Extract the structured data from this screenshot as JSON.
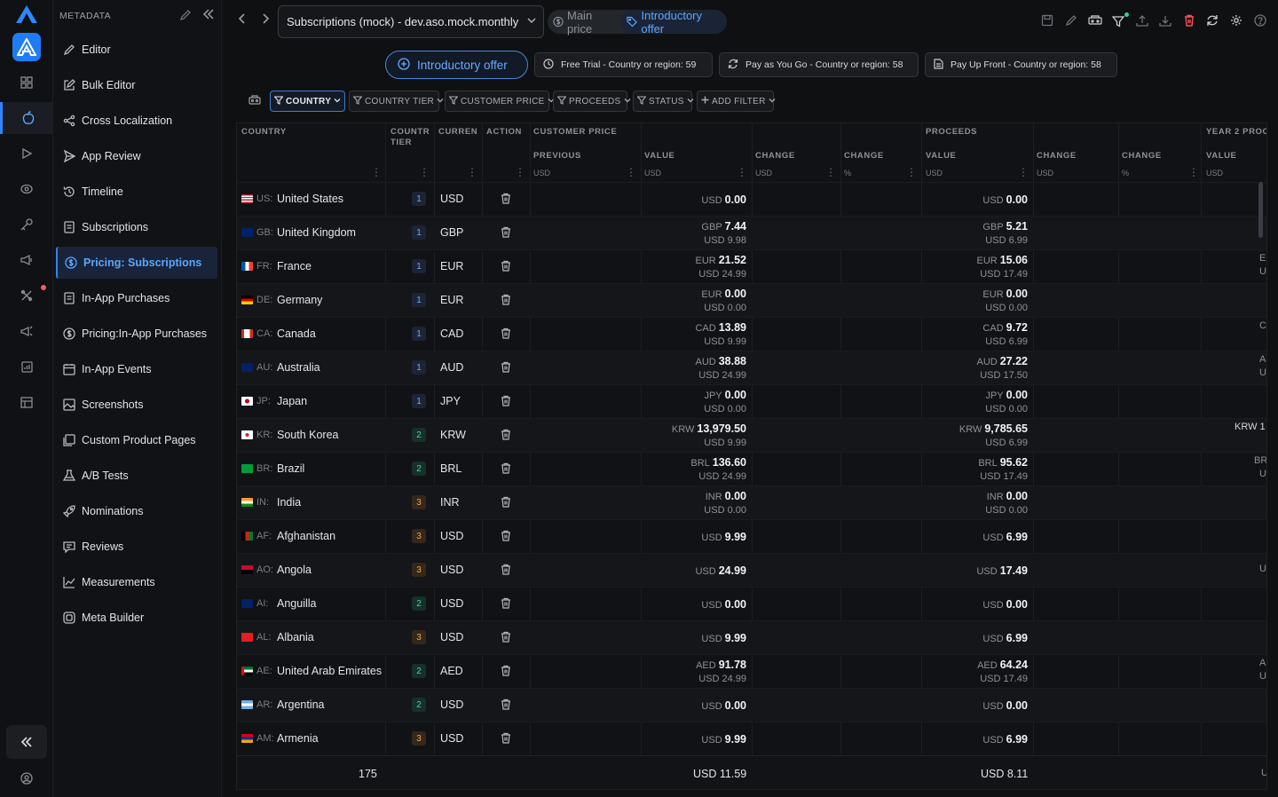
{
  "sidebar": {
    "title": "METADATA",
    "items": [
      {
        "label": "Editor",
        "icon": "pencil-icon"
      },
      {
        "label": "Bulk Editor",
        "icon": "edit-box-icon"
      },
      {
        "label": "Cross Localization",
        "icon": "share-icon"
      },
      {
        "label": "App Review",
        "icon": "send-icon"
      },
      {
        "label": "Timeline",
        "icon": "history-icon"
      },
      {
        "label": "Subscriptions",
        "icon": "document-icon"
      },
      {
        "label": "Pricing: Subscriptions",
        "icon": "dollar-circle-icon",
        "active": true
      },
      {
        "label": "In-App Purchases",
        "icon": "document-icon"
      },
      {
        "label": "Pricing:In-App Purchases",
        "icon": "dollar-circle-icon"
      },
      {
        "label": "In-App Events",
        "icon": "calendar-icon"
      },
      {
        "label": "Screenshots",
        "icon": "image-icon"
      },
      {
        "label": "Custom Product Pages",
        "icon": "pages-icon"
      },
      {
        "label": "A/B Tests",
        "icon": "flask-icon"
      },
      {
        "label": "Nominations",
        "icon": "rocket-icon"
      },
      {
        "label": "Reviews",
        "icon": "reviews-icon"
      },
      {
        "label": "Measurements",
        "icon": "chart-icon"
      },
      {
        "label": "Meta Builder",
        "icon": "builder-icon"
      }
    ]
  },
  "topbar": {
    "selector_value": "Subscriptions (mock) - dev.aso.mock.monthly",
    "segment_main": "Main price",
    "segment_intro": "Introductory offer"
  },
  "offers": {
    "main_label": "Introductory offer",
    "chips": [
      "Free Trial - Country or region: 59",
      "Pay as You Go - Country or region: 58",
      "Pay Up Front - Country or region: 58"
    ]
  },
  "filters": [
    {
      "label": "COUNTRY",
      "active": true
    },
    {
      "label": "COUNTRY TIER"
    },
    {
      "label": "CUSTOMER PRICE"
    },
    {
      "label": "PROCEEDS"
    },
    {
      "label": "STATUS"
    },
    {
      "label": "ADD FILTER",
      "add": true
    }
  ],
  "table": {
    "headers": {
      "country": "COUNTRY",
      "tier": "COUNTR TIER",
      "currency": "CURREN",
      "action": "ACTION",
      "customer_price": "CUSTOMER PRICE",
      "proceeds": "PROCEEDS",
      "year2": "YEAR 2 PROC"
    },
    "subheaders": {
      "previous": "PREVIOUS",
      "value": "VALUE",
      "change": "CHANGE",
      "change2": "CHANGE",
      "p_value": "VALUE",
      "p_change": "CHANGE",
      "p_change2": "CHANGE",
      "y_value": "VALUE"
    },
    "units": {
      "previous": "USD",
      "value": "USD",
      "change": "USD",
      "change_pct": "%",
      "p_value": "USD",
      "p_change": "USD",
      "p_change_pct": "%",
      "y_value": "USD"
    },
    "rows": [
      {
        "code": "US:",
        "country": "United States",
        "tier": "1",
        "currency": "USD",
        "price_cur": "USD",
        "price": "0.00",
        "price_usd": "",
        "proc_cur": "USD",
        "proc": "0.00",
        "proc_usd": "",
        "y2": "",
        "flag": "us"
      },
      {
        "code": "GB:",
        "country": "United Kingdom",
        "tier": "1",
        "currency": "GBP",
        "price_cur": "GBP",
        "price": "7.44",
        "price_usd": "USD 9.98",
        "proc_cur": "GBP",
        "proc": "5.21",
        "proc_usd": "USD 6.99",
        "y2": "",
        "flag": "gb"
      },
      {
        "code": "FR:",
        "country": "France",
        "tier": "1",
        "currency": "EUR",
        "price_cur": "EUR",
        "price": "21.52",
        "price_usd": "USD 24.99",
        "proc_cur": "EUR",
        "proc": "15.06",
        "proc_usd": "USD 17.49",
        "y2": "E",
        "y2b": "U",
        "flag": "fr"
      },
      {
        "code": "DE:",
        "country": "Germany",
        "tier": "1",
        "currency": "EUR",
        "price_cur": "EUR",
        "price": "0.00",
        "price_usd": "USD 0.00",
        "proc_cur": "EUR",
        "proc": "0.00",
        "proc_usd": "USD 0.00",
        "y2": "",
        "flag": "de"
      },
      {
        "code": "CA:",
        "country": "Canada",
        "tier": "1",
        "currency": "CAD",
        "price_cur": "CAD",
        "price": "13.89",
        "price_usd": "USD 9.99",
        "proc_cur": "CAD",
        "proc": "9.72",
        "proc_usd": "USD 6.99",
        "y2": "C",
        "flag": "ca"
      },
      {
        "code": "AU:",
        "country": "Australia",
        "tier": "1",
        "currency": "AUD",
        "price_cur": "AUD",
        "price": "38.88",
        "price_usd": "USD 24.99",
        "proc_cur": "AUD",
        "proc": "27.22",
        "proc_usd": "USD 17.50",
        "y2": "A",
        "y2b": "U",
        "flag": "au"
      },
      {
        "code": "JP:",
        "country": "Japan",
        "tier": "1",
        "currency": "JPY",
        "price_cur": "JPY",
        "price": "0.00",
        "price_usd": "USD 0.00",
        "proc_cur": "JPY",
        "proc": "0.00",
        "proc_usd": "USD 0.00",
        "y2": "",
        "flag": "jp"
      },
      {
        "code": "KR:",
        "country": "South Korea",
        "tier": "2",
        "currency": "KRW",
        "price_cur": "KRW",
        "price": "13,979.50",
        "price_usd": "USD 9.99",
        "proc_cur": "KRW",
        "proc": "9,785.65",
        "proc_usd": "USD 6.99",
        "y2": "KRW 1",
        "flag": "kr"
      },
      {
        "code": "BR:",
        "country": "Brazil",
        "tier": "2",
        "currency": "BRL",
        "price_cur": "BRL",
        "price": "136.60",
        "price_usd": "USD 24.99",
        "proc_cur": "BRL",
        "proc": "95.62",
        "proc_usd": "USD 17.49",
        "y2": "BR",
        "y2b": "U",
        "flag": "br"
      },
      {
        "code": "IN:",
        "country": "India",
        "tier": "3",
        "currency": "INR",
        "price_cur": "INR",
        "price": "0.00",
        "price_usd": "USD 0.00",
        "proc_cur": "INR",
        "proc": "0.00",
        "proc_usd": "USD 0.00",
        "y2": "",
        "flag": "in"
      },
      {
        "code": "AF:",
        "country": "Afghanistan",
        "tier": "3",
        "currency": "USD",
        "price_cur": "USD",
        "price": "9.99",
        "price_usd": "",
        "proc_cur": "USD",
        "proc": "6.99",
        "proc_usd": "",
        "y2": "",
        "flag": "af"
      },
      {
        "code": "AO:",
        "country": "Angola",
        "tier": "3",
        "currency": "USD",
        "price_cur": "USD",
        "price": "24.99",
        "price_usd": "",
        "proc_cur": "USD",
        "proc": "17.49",
        "proc_usd": "",
        "y2": "U",
        "flag": "ao"
      },
      {
        "code": "AI:",
        "country": "Anguilla",
        "tier": "2",
        "currency": "USD",
        "price_cur": "USD",
        "price": "0.00",
        "price_usd": "",
        "proc_cur": "USD",
        "proc": "0.00",
        "proc_usd": "",
        "y2": "",
        "flag": "ai"
      },
      {
        "code": "AL:",
        "country": "Albania",
        "tier": "3",
        "currency": "USD",
        "price_cur": "USD",
        "price": "9.99",
        "price_usd": "",
        "proc_cur": "USD",
        "proc": "6.99",
        "proc_usd": "",
        "y2": "",
        "flag": "al"
      },
      {
        "code": "AE:",
        "country": "United Arab Emirates",
        "tier": "2",
        "currency": "AED",
        "price_cur": "AED",
        "price": "91.78",
        "price_usd": "USD 24.99",
        "proc_cur": "AED",
        "proc": "64.24",
        "proc_usd": "USD 17.49",
        "y2": "A",
        "y2b": "U",
        "flag": "ae"
      },
      {
        "code": "AR:",
        "country": "Argentina",
        "tier": "2",
        "currency": "USD",
        "price_cur": "USD",
        "price": "0.00",
        "price_usd": "",
        "proc_cur": "USD",
        "proc": "0.00",
        "proc_usd": "",
        "y2": "",
        "flag": "ar"
      },
      {
        "code": "AM:",
        "country": "Armenia",
        "tier": "3",
        "currency": "USD",
        "price_cur": "USD",
        "price": "9.99",
        "price_usd": "",
        "proc_cur": "USD",
        "proc": "6.99",
        "proc_usd": "",
        "y2": "",
        "flag": "am"
      }
    ],
    "footer": {
      "count": "175",
      "price": "USD 11.59",
      "proceeds": "USD 8.11",
      "y2": "U"
    }
  },
  "colors": {
    "accent": "#2f86ff",
    "danger": "#ff4d55",
    "tier1": "#6aa8ff",
    "tier2": "#4ad39a",
    "tier3": "#f0a54a"
  }
}
